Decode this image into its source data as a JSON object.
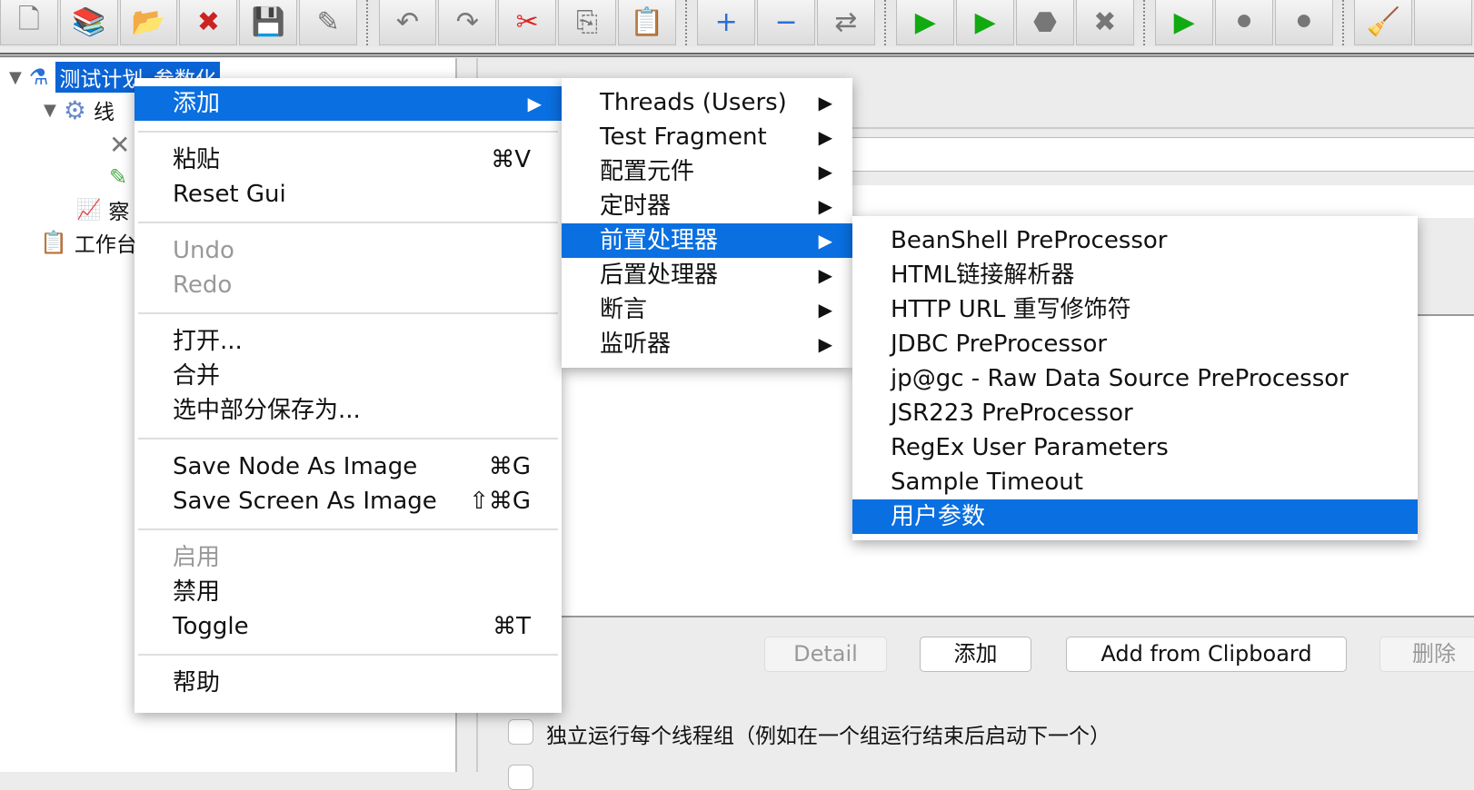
{
  "toolbar": {
    "buttons": [
      [
        "new-icon",
        "🗋"
      ],
      [
        "templates-icon",
        "📚"
      ],
      [
        "open-icon",
        "📂"
      ],
      [
        "close-icon",
        "✖"
      ],
      [
        "save-icon",
        "💾"
      ],
      [
        "save-as-icon",
        "✎"
      ],
      "sep",
      [
        "undo-icon",
        "↶"
      ],
      [
        "redo-icon",
        "↷"
      ],
      [
        "cut-icon",
        "✂"
      ],
      [
        "copy-icon",
        "⎘"
      ],
      [
        "paste-icon",
        "📋"
      ],
      "sep",
      [
        "expand-icon",
        "+"
      ],
      [
        "collapse-icon",
        "−"
      ],
      [
        "toggle-icon",
        "⇄"
      ],
      "sep",
      [
        "start-icon",
        "▶"
      ],
      [
        "start-no-pause-icon",
        "▶"
      ],
      [
        "stop-icon",
        "⬣"
      ],
      [
        "shutdown-icon",
        "✖"
      ],
      "sep",
      [
        "remote-start-icon",
        "▶"
      ],
      [
        "remote-stop-icon",
        "⚫"
      ],
      [
        "remote-shutdown-icon",
        "⚫"
      ],
      "sep",
      [
        "clear-icon",
        "🧹"
      ],
      [
        "clear-all-icon",
        ""
      ]
    ]
  },
  "tree": {
    "root": "测试计划_参数化",
    "thread_group": "线",
    "listener": "察",
    "workbench": "工作台"
  },
  "context_menu": {
    "items": [
      {
        "label": "添加",
        "submenu": true,
        "highlighted": true
      },
      "sep",
      {
        "label": "粘贴",
        "shortcut": "⌘V"
      },
      {
        "label": "Reset Gui"
      },
      "sep",
      {
        "label": "Undo",
        "disabled": true
      },
      {
        "label": "Redo",
        "disabled": true
      },
      "sep",
      {
        "label": "打开..."
      },
      {
        "label": "合并"
      },
      {
        "label": "选中部分保存为..."
      },
      "sep",
      {
        "label": "Save Node As Image",
        "shortcut": "⌘G"
      },
      {
        "label": "Save Screen As Image",
        "shortcut": "⇧⌘G"
      },
      "sep",
      {
        "label": "启用",
        "disabled": true
      },
      {
        "label": "禁用"
      },
      {
        "label": "Toggle",
        "shortcut": "⌘T"
      },
      "sep",
      {
        "label": "帮助"
      }
    ]
  },
  "add_submenu": {
    "items": [
      {
        "label": "Threads (Users)"
      },
      {
        "label": "Test Fragment"
      },
      {
        "label": "配置元件"
      },
      {
        "label": "定时器"
      },
      {
        "label": "前置处理器",
        "highlighted": true
      },
      {
        "label": "后置处理器"
      },
      {
        "label": "断言"
      },
      {
        "label": "监听器"
      }
    ]
  },
  "preprocessor_submenu": {
    "items": [
      {
        "label": "BeanShell PreProcessor"
      },
      {
        "label": "HTML链接解析器"
      },
      {
        "label": "HTTP URL 重写修饰符"
      },
      {
        "label": "JDBC PreProcessor"
      },
      {
        "label": "jp@gc - Raw Data Source PreProcessor"
      },
      {
        "label": "JSR223 PreProcessor"
      },
      {
        "label": "RegEx User Parameters"
      },
      {
        "label": "Sample Timeout"
      },
      {
        "label": "用户参数",
        "highlighted": true
      }
    ]
  },
  "panel": {
    "detail": "Detail",
    "add": "添加",
    "add_clipboard": "Add from Clipboard",
    "delete": "删除",
    "checkbox_label": "独立运行每个线程组（例如在一个组运行结束后启动下一个）",
    "checkbox_checked": false
  },
  "colors": {
    "highlight": "#0a6fe0",
    "selection": "#0a64d6"
  }
}
